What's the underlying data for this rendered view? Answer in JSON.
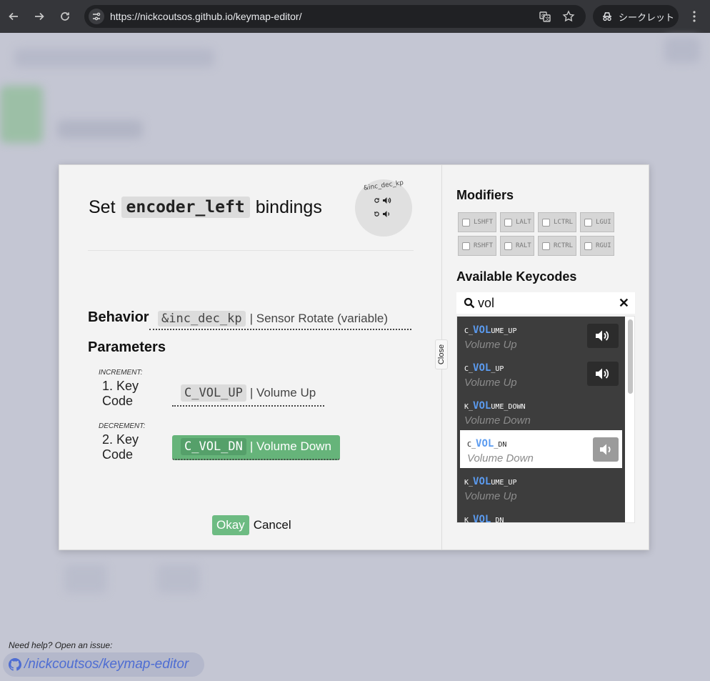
{
  "browser": {
    "url": "https://nickcoutsos.github.io/keymap-editor/",
    "incognito_label": "シークレット"
  },
  "modal": {
    "title_prefix": "Set",
    "title_code": "encoder_left",
    "title_suffix": "bindings",
    "encoder_preview": {
      "label": "&inc_dec_kp"
    },
    "behavior": {
      "label": "Behavior",
      "code": "&inc_dec_kp",
      "description": "| Sensor Rotate (variable)"
    },
    "parameters_label": "Parameters",
    "params": [
      {
        "name": "increment:",
        "number": "1. Key Code",
        "code": "C_VOL_UP",
        "description": "| Volume Up"
      },
      {
        "name": "decrement:",
        "number": "2. Key Code",
        "code": "C_VOL_DN",
        "description": "| Volume Down"
      }
    ],
    "okay_label": "Okay",
    "cancel_label": "Cancel",
    "close_label": "Close"
  },
  "sidebar": {
    "modifiers_heading": "Modifiers",
    "modifiers": [
      "LSHFT",
      "LALT",
      "LCTRL",
      "LGUI",
      "RSHFT",
      "RALT",
      "RCTRL",
      "RGUI"
    ],
    "keycodes_heading": "Available Keycodes",
    "search_value": "vol",
    "results": [
      {
        "prefix": "C_",
        "match": "VOL",
        "suffix": "UME_UP",
        "desc": "Volume Up",
        "icon": "volume-up-icon"
      },
      {
        "prefix": "C_",
        "match": "VOL",
        "suffix": "_UP",
        "desc": "Volume Up",
        "icon": "volume-up-icon"
      },
      {
        "prefix": "K_",
        "match": "VOL",
        "suffix": "UME_DOWN",
        "desc": "Volume Down",
        "icon": ""
      },
      {
        "prefix": "C_",
        "match": "VOL",
        "suffix": "_DN",
        "desc": "Volume Down",
        "icon": "volume-down-icon",
        "selected": true
      },
      {
        "prefix": "K_",
        "match": "VOL",
        "suffix": "UME_UP",
        "desc": "Volume Up",
        "icon": ""
      },
      {
        "prefix": "K_",
        "match": "VOL",
        "suffix": "_DN",
        "desc": "",
        "icon": ""
      }
    ]
  },
  "footer": {
    "help_text": "Need help? Open an issue:",
    "repo_link": "/nickcoutsos/keymap-editor"
  }
}
